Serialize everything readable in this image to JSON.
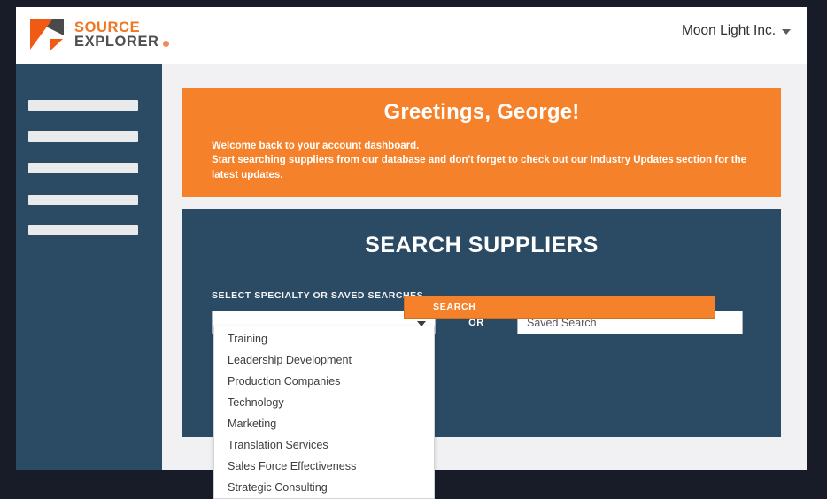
{
  "brand": {
    "logo_line1": "SOURCE",
    "logo_line2": "EXPLORER",
    "logo_registered": "registered-mark",
    "accent_orange": "#f5822a",
    "logo_orange": "#f05a14",
    "navy": "#2b4a64",
    "page_bg": "#f1f1f3",
    "frame": "#171c28"
  },
  "header": {
    "account_name": "Moon Light Inc.",
    "caret_icon": "chevron-down-icon"
  },
  "sidebar": {
    "items": [
      {
        "label": ""
      },
      {
        "label": ""
      },
      {
        "label": ""
      },
      {
        "label": ""
      },
      {
        "label": ""
      }
    ]
  },
  "greeting": {
    "title": "Greetings, George!",
    "line1": "Welcome back to your account dashboard.",
    "line2": "Start searching suppliers from our database and don't forget to check out our Industry Updates section for the latest updates."
  },
  "search": {
    "title": "SEARCH SUPPLIERS",
    "select_label": "SELECT SPECIALTY OR SAVED SEARCHES",
    "specialty_value": "",
    "specialty_caret_icon": "chevron-down-icon",
    "or_label": "OR",
    "saved_search_placeholder": "Saved Search",
    "saved_search_value": "",
    "search_button_label": "SEARCH",
    "dropdown_open": true,
    "dropdown_options": [
      "Training",
      "Leadership Development",
      "Production Companies",
      "Technology",
      "Marketing",
      "Translation Services",
      "Sales Force Effectiveness",
      "Strategic Consulting"
    ]
  }
}
